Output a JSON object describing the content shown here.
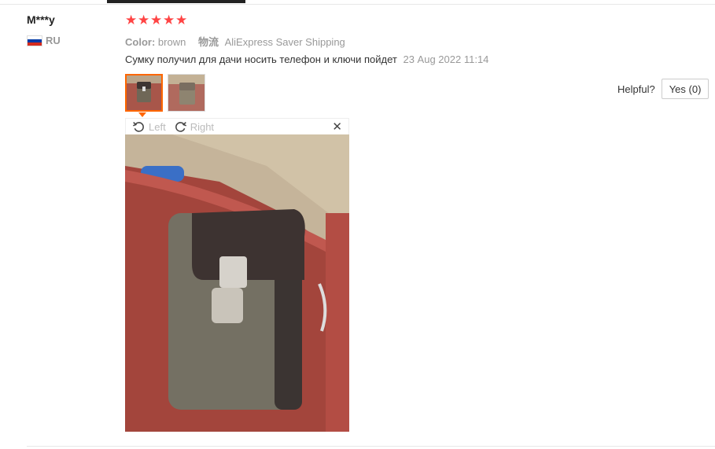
{
  "reviewer": {
    "name": "M***y",
    "country_code": "RU",
    "flag_icon": "russia-flag-icon"
  },
  "rating": {
    "stars": 5,
    "max": 5,
    "color": "#ff4444"
  },
  "attributes": {
    "color_label": "Color:",
    "color_value": "brown",
    "shipping_label": "物流",
    "shipping_value": "AliExpress Saver Shipping"
  },
  "review": {
    "text": "Сумку получил для дачи носить телефон и ключи пойдет",
    "date": "23 Aug 2022 11:14"
  },
  "thumbnails": [
    {
      "icon": "photo-thumbnail-1",
      "selected": true
    },
    {
      "icon": "photo-thumbnail-2",
      "selected": false
    }
  ],
  "helpful": {
    "label": "Helpful?",
    "yes_button": "Yes (0)"
  },
  "viewer": {
    "rotate_left": "Left",
    "rotate_right": "Right",
    "close": "✕"
  },
  "colors": {
    "accent": "#ff6600",
    "muted": "#999999"
  }
}
